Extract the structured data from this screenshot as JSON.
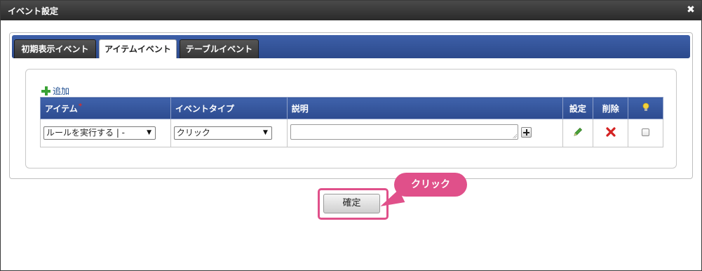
{
  "dialog": {
    "title": "イベント設定",
    "close_symbol": "✖"
  },
  "tabs": [
    {
      "label": "初期表示イベント",
      "active": false
    },
    {
      "label": "アイテムイベント",
      "active": true
    },
    {
      "label": "テーブルイベント",
      "active": false
    }
  ],
  "grid": {
    "add_label": "追加",
    "required_mark": "*",
    "headers": {
      "item": "アイテム",
      "event_type": "イベントタイプ",
      "description": "説明",
      "settings": "設定",
      "delete": "削除"
    },
    "rows": [
      {
        "item": "ルールを実行する | -",
        "event_type": "クリック",
        "description": ""
      }
    ]
  },
  "footer": {
    "confirm_label": "確定",
    "callout_label": "クリック"
  },
  "colors": {
    "tabbar": "#2c4a8c",
    "header": "#2d4b8f",
    "callout": "#e0508a",
    "add_green": "#3aa235"
  },
  "icons": {
    "close": "close-icon",
    "add": "plus-icon",
    "hint": "lightbulb-icon",
    "edit": "pencil-icon",
    "delete": "delete-icon",
    "expand": "expand-icon"
  }
}
